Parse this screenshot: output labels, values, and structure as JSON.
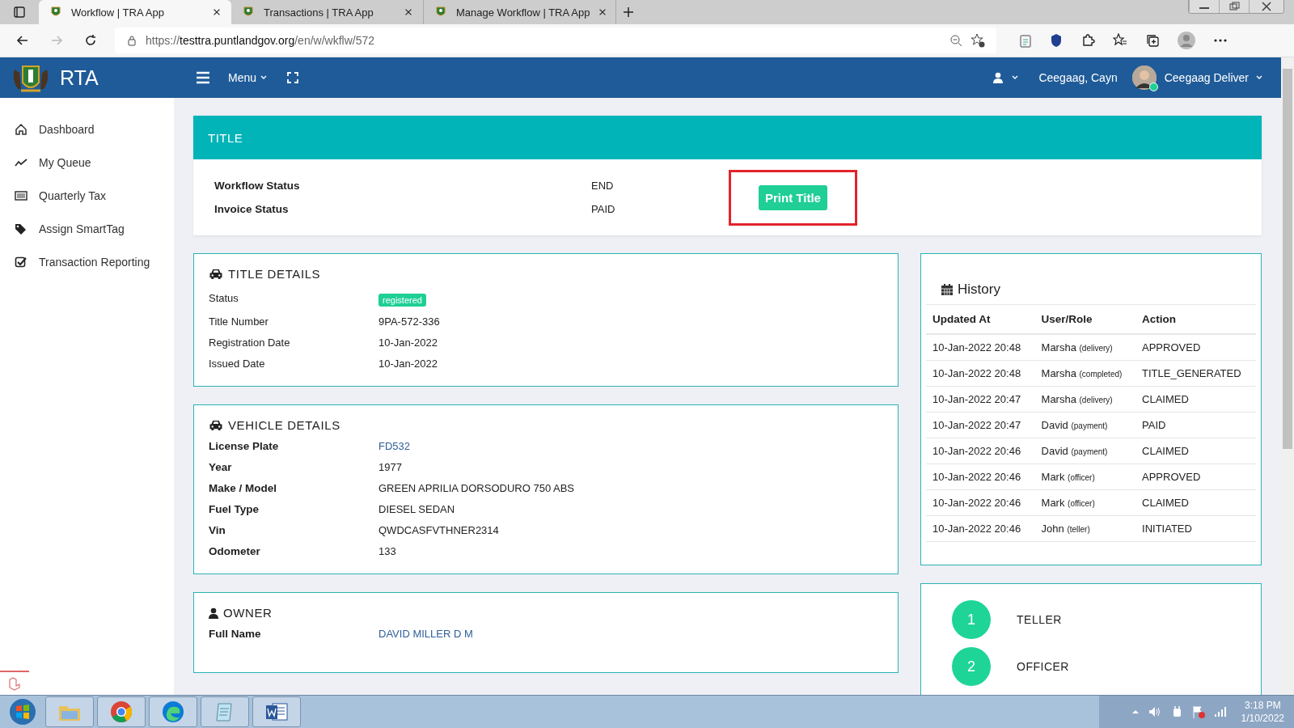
{
  "browser": {
    "tabs": [
      {
        "title": "Workflow | TRA App",
        "selected": true
      },
      {
        "title": "Transactions | TRA App",
        "selected": false
      },
      {
        "title": "Manage Workflow | TRA App",
        "selected": false
      }
    ],
    "url_scheme": "https://",
    "url_host": "testtra.puntlandgov.org",
    "url_path": "/en/w/wkflw/572"
  },
  "header": {
    "brand": "RTA",
    "menu": "Menu",
    "user_name": "Ceegaag, Cayn",
    "profile": "Ceegaag Deliver"
  },
  "sidebar": {
    "items": [
      {
        "label": "Dashboard",
        "kind": "home"
      },
      {
        "label": "My Queue",
        "kind": "trend"
      },
      {
        "label": "Quarterly Tax",
        "kind": "list"
      },
      {
        "label": "Assign SmartTag",
        "kind": "tags"
      },
      {
        "label": "Transaction Reporting",
        "kind": "check"
      }
    ]
  },
  "title_panel": {
    "heading": "TITLE",
    "rows": [
      {
        "label": "Workflow Status",
        "value": "END"
      },
      {
        "label": "Invoice Status",
        "value": "PAID"
      }
    ],
    "button": {
      "label": "Print Title",
      "highlighted": true
    }
  },
  "title_details": {
    "heading": "TITLE DETAILS",
    "rows": [
      {
        "label": "Status",
        "value": "registered",
        "kind": "badge"
      },
      {
        "label": "Title Number",
        "value": "9PA-572-336",
        "kind": "text"
      },
      {
        "label": "Registration Date",
        "value": "10-Jan-2022",
        "kind": "text"
      },
      {
        "label": "Issued Date",
        "value": "10-Jan-2022",
        "kind": "text"
      }
    ]
  },
  "vehicle_details": {
    "heading": "VEHICLE DETAILS",
    "rows": [
      {
        "label": "License Plate",
        "value": "FD532",
        "kind": "link"
      },
      {
        "label": "Year",
        "value": "1977",
        "kind": "text"
      },
      {
        "label": "Make / Model",
        "value": "GREEN APRILIA DORSODURO 750 ABS",
        "kind": "text"
      },
      {
        "label": "Fuel Type",
        "value": "DIESEL SEDAN",
        "kind": "text"
      },
      {
        "label": "Vin",
        "value": "QWDCASFVTHNER2314",
        "kind": "text"
      },
      {
        "label": "Odometer",
        "value": "133",
        "kind": "text"
      }
    ]
  },
  "owner": {
    "heading": "OWNER",
    "rows": [
      {
        "label": "Full Name",
        "value": "DAVID MILLER D M",
        "kind": "link"
      }
    ]
  },
  "history": {
    "heading": "History",
    "columns": [
      "Updated At",
      "User/Role",
      "Action"
    ],
    "rows": [
      {
        "updated_at": "10-Jan-2022 20:48",
        "user": "Marsha",
        "role": "(delivery)",
        "action": "APPROVED"
      },
      {
        "updated_at": "10-Jan-2022 20:48",
        "user": "Marsha",
        "role": "(completed)",
        "action": "TITLE_GENERATED"
      },
      {
        "updated_at": "10-Jan-2022 20:47",
        "user": "Marsha",
        "role": "(delivery)",
        "action": "CLAIMED"
      },
      {
        "updated_at": "10-Jan-2022 20:47",
        "user": "David",
        "role": "(payment)",
        "action": "PAID"
      },
      {
        "updated_at": "10-Jan-2022 20:46",
        "user": "David",
        "role": "(payment)",
        "action": "CLAIMED"
      },
      {
        "updated_at": "10-Jan-2022 20:46",
        "user": "Mark",
        "role": "(officer)",
        "action": "APPROVED"
      },
      {
        "updated_at": "10-Jan-2022 20:46",
        "user": "Mark",
        "role": "(officer)",
        "action": "CLAIMED"
      },
      {
        "updated_at": "10-Jan-2022 20:46",
        "user": "John",
        "role": "(teller)",
        "action": "INITIATED"
      }
    ]
  },
  "steps": [
    {
      "number": "1",
      "label": "TELLER"
    },
    {
      "number": "2",
      "label": "OFFICER"
    }
  ],
  "taskbar": {
    "time": "3:18 PM",
    "date": "1/10/2022"
  }
}
